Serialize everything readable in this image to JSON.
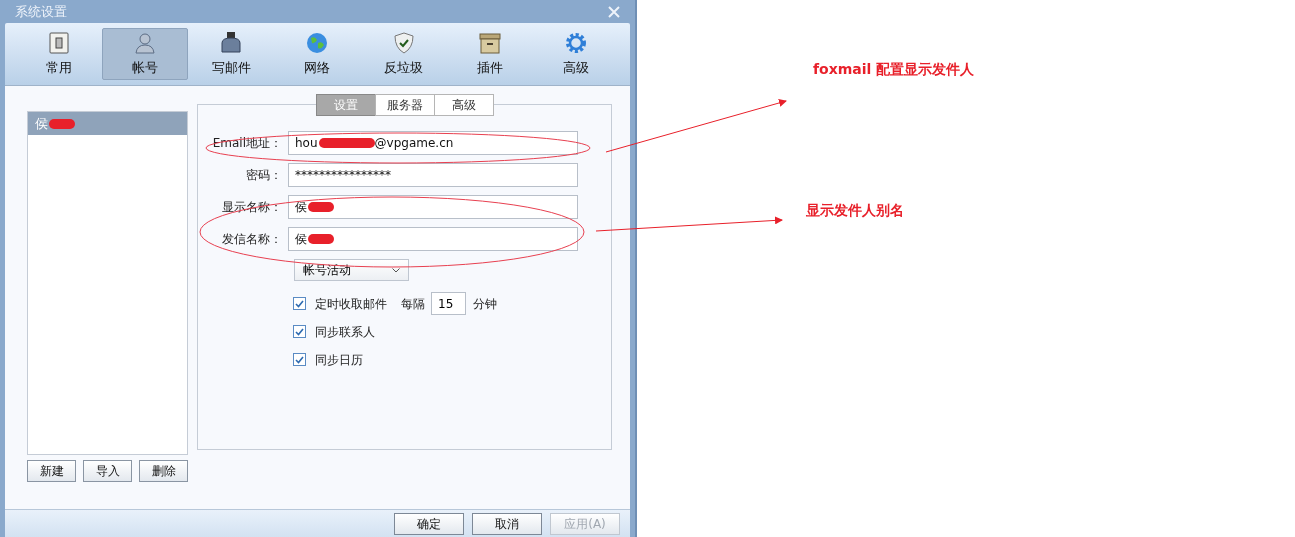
{
  "window": {
    "title": "系统设置"
  },
  "toolbar": [
    {
      "label": "常用",
      "kind": "switch",
      "selected": false
    },
    {
      "label": "帐号",
      "kind": "person",
      "selected": true
    },
    {
      "label": "写邮件",
      "kind": "ink",
      "selected": false
    },
    {
      "label": "网络",
      "kind": "globe",
      "selected": false
    },
    {
      "label": "反垃圾",
      "kind": "shield",
      "selected": false
    },
    {
      "label": "插件",
      "kind": "box",
      "selected": false
    },
    {
      "label": "高级",
      "kind": "gear",
      "selected": false
    }
  ],
  "accounts": {
    "items": [
      {
        "name": "侯",
        "redacted": true,
        "selected": true
      }
    ],
    "buttons": [
      "新建",
      "导入",
      "删除"
    ]
  },
  "tabs": [
    {
      "label": "设置",
      "selected": true
    },
    {
      "label": "服务器",
      "selected": false
    },
    {
      "label": "高级",
      "selected": false
    }
  ],
  "fields": [
    {
      "label": "Email地址：",
      "value": "hou",
      "value_end": "@vpgame.cn",
      "redacted": true
    },
    {
      "label": "密码：",
      "value": "****************",
      "redacted": false
    },
    {
      "label": "显示名称：",
      "value": "侯",
      "redacted": true
    },
    {
      "label": "发信名称：",
      "value": "侯",
      "redacted": true
    }
  ],
  "dropdown": {
    "value": "帐号活动"
  },
  "checkboxes": [
    {
      "label": "定时收取邮件",
      "checked": true,
      "every": "每隔",
      "interval": "15",
      "unit": "分钟"
    },
    {
      "label": "同步联系人",
      "checked": true
    },
    {
      "label": "同步日历",
      "checked": true
    }
  ],
  "footer_buttons": [
    {
      "label": "确定",
      "disabled": false
    },
    {
      "label": "取消",
      "disabled": false
    },
    {
      "label": "应用(A)",
      "disabled": true
    }
  ],
  "annotations": [
    {
      "text": "foxmail 配置显示发件人"
    },
    {
      "text": "显示发件人别名"
    }
  ]
}
